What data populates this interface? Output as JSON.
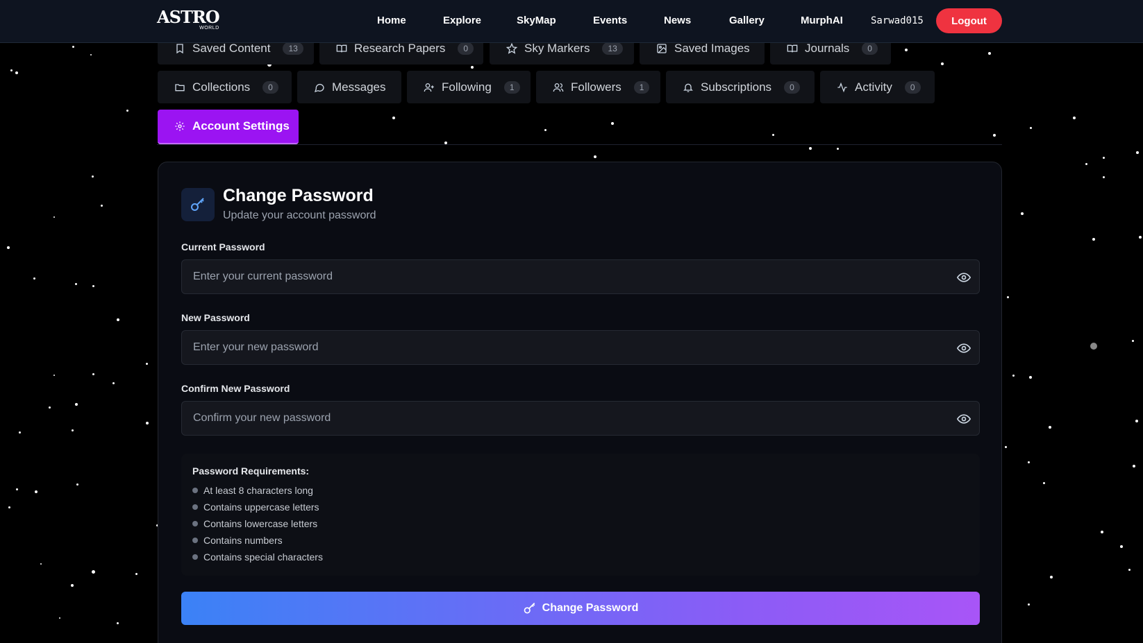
{
  "navbar": {
    "logo_main": "ASTRO",
    "logo_sub": "WORLD",
    "links": [
      "Home",
      "Explore",
      "SkyMap",
      "Events",
      "News",
      "Gallery",
      "MurphAI"
    ],
    "username": "Sarwad015",
    "logout_label": "Logout"
  },
  "tabs": [
    {
      "label": "Saved Content",
      "count": "13",
      "icon": "bookmark-icon"
    },
    {
      "label": "Research Papers",
      "count": "0",
      "icon": "book-open-icon"
    },
    {
      "label": "Sky Markers",
      "count": "13",
      "icon": "star-icon"
    },
    {
      "label": "Saved Images",
      "count": "",
      "icon": "image-icon"
    },
    {
      "label": "Journals",
      "count": "0",
      "icon": "book-open-icon"
    },
    {
      "label": "Collections",
      "count": "0",
      "icon": "folder-icon"
    },
    {
      "label": "Messages",
      "count": "",
      "icon": "message-icon"
    },
    {
      "label": "Following",
      "count": "1",
      "icon": "user-plus-icon"
    },
    {
      "label": "Followers",
      "count": "1",
      "icon": "users-icon"
    },
    {
      "label": "Subscriptions",
      "count": "0",
      "icon": "bell-icon"
    },
    {
      "label": "Activity",
      "count": "0",
      "icon": "activity-icon"
    },
    {
      "label": "Account Settings",
      "count": "",
      "icon": "gear-icon",
      "active": true
    }
  ],
  "card": {
    "title": "Change Password",
    "subtitle": "Update your account password",
    "fields": [
      {
        "label": "Current Password",
        "placeholder": "Enter your current password",
        "value": ""
      },
      {
        "label": "New Password",
        "placeholder": "Enter your new password",
        "value": ""
      },
      {
        "label": "Confirm New Password",
        "placeholder": "Confirm your new password",
        "value": ""
      }
    ],
    "requirements_title": "Password Requirements:",
    "requirements": [
      "At least 8 characters long",
      "Contains uppercase letters",
      "Contains lowercase letters",
      "Contains numbers",
      "Contains special characters"
    ],
    "submit_label": "Change Password"
  },
  "colors": {
    "accent_purple": "#9b14f2",
    "logout_red": "#ef3340",
    "gradient_start": "#3b82f6",
    "gradient_end": "#a855f7"
  }
}
